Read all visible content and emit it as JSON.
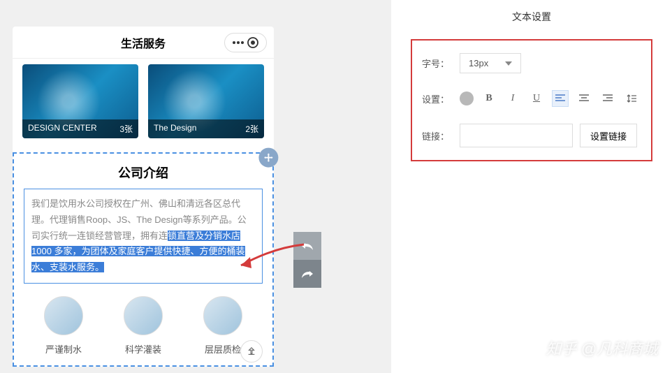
{
  "header": {
    "title": "生活服务"
  },
  "images": [
    {
      "label": "DESIGN CENTER",
      "count": "3张"
    },
    {
      "label": "The Design",
      "count": "2张"
    }
  ],
  "company": {
    "title": "公司介绍",
    "text_plain": "我们是饮用水公司授权在广州、佛山和清远各区总代理。代理销售Roop、JS、The Design等系列产品。公司实行统一连锁经营管理，拥有连",
    "text_highlight": "锁直营及分销水店1000 多家，为团体及家庭客户提供快捷、方便的桶装水、支装水服务。"
  },
  "features": [
    {
      "label": "严谨制水"
    },
    {
      "label": "科学灌装"
    },
    {
      "label": "层层质检"
    }
  ],
  "panel": {
    "title": "文本设置",
    "font_label": "字号：",
    "font_value": "13px",
    "setting_label": "设置：",
    "link_label": "链接：",
    "link_value": "",
    "link_button": "设置链接"
  },
  "watermark": "知乎 @凡科商城"
}
